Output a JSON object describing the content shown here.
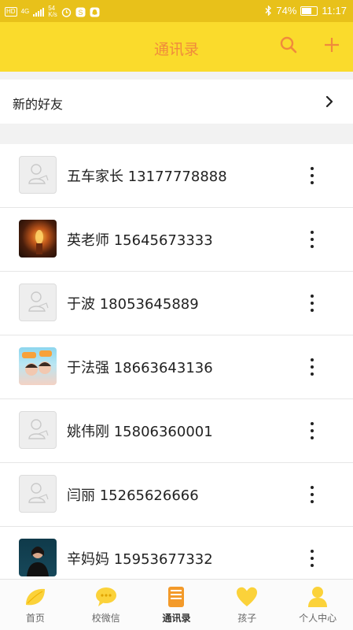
{
  "status_bar": {
    "hd": "HD",
    "network": "4G",
    "speed_value": "54",
    "speed_unit": "K/s",
    "battery_percent": "74%",
    "battery_level": 0.74,
    "time": "11:17"
  },
  "header": {
    "title": "通讯录",
    "accent": "#fadb2c",
    "title_color": "#f08a3c"
  },
  "new_friends": {
    "label": "新的好友"
  },
  "contacts": [
    {
      "label": "五车家长 13177778888",
      "avatar": "default-avatar"
    },
    {
      "label": "英老师 15645673333",
      "avatar": "candle-photo"
    },
    {
      "label": "于波 18053645889",
      "avatar": "default-avatar"
    },
    {
      "label": "于法强 18663643136",
      "avatar": "kids-photo"
    },
    {
      "label": "姚伟刚 15806360001",
      "avatar": "default-avatar"
    },
    {
      "label": "闫丽 15265626666",
      "avatar": "default-avatar"
    },
    {
      "label": "辛妈妈 15953677332",
      "avatar": "woman-photo"
    }
  ],
  "bottom_nav": [
    {
      "label": "首页",
      "icon": "leaf-icon"
    },
    {
      "label": "校微信",
      "icon": "chat-bubble-icon"
    },
    {
      "label": "通讯录",
      "icon": "contacts-book-icon",
      "active": true
    },
    {
      "label": "孩子",
      "icon": "heart-icon"
    },
    {
      "label": "个人中心",
      "icon": "person-icon"
    }
  ]
}
